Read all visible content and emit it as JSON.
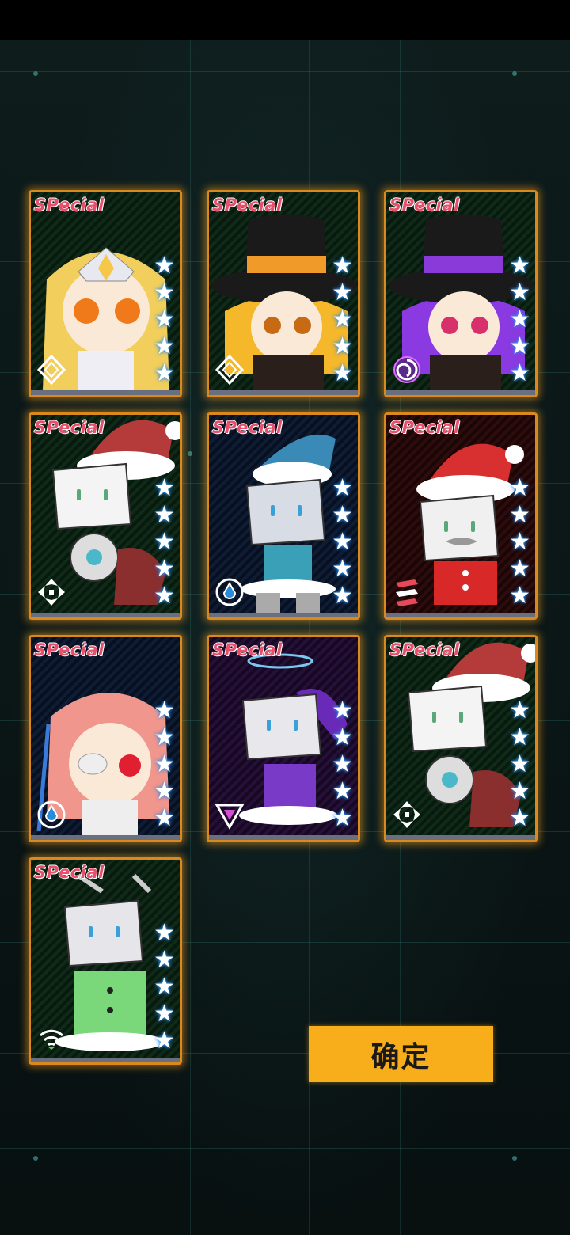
{
  "confirm_label": "确定",
  "cards": [
    {
      "rarity": "SPecial",
      "stars": 5,
      "theme": "green",
      "class_icon": "diamond-class-icon",
      "character": "golden-haired-crowned-character"
    },
    {
      "rarity": "SPecial",
      "stars": 5,
      "theme": "green",
      "class_icon": "diamond-class-icon",
      "character": "top-hat-orange-band-character"
    },
    {
      "rarity": "SPecial",
      "stars": 5,
      "theme": "green",
      "class_icon": "swirl-class-icon",
      "character": "top-hat-purple-band-character"
    },
    {
      "rarity": "SPecial",
      "stars": 5,
      "theme": "green",
      "class_icon": "crosshair-class-icon",
      "character": "box-head-santa-hat-spider-character"
    },
    {
      "rarity": "SPecial",
      "stars": 5,
      "theme": "blue",
      "class_icon": "drop-class-icon",
      "character": "box-head-blue-nightcap-character"
    },
    {
      "rarity": "SPecial",
      "stars": 5,
      "theme": "red",
      "class_icon": "slash-class-icon",
      "character": "box-head-santa-mustache-character"
    },
    {
      "rarity": "SPecial",
      "stars": 5,
      "theme": "blue",
      "class_icon": "drop-class-icon",
      "character": "pink-haired-eyepatch-character"
    },
    {
      "rarity": "SPecial",
      "stars": 5,
      "theme": "purple",
      "class_icon": "triangle-class-icon",
      "character": "box-head-halo-purple-character"
    },
    {
      "rarity": "SPecial",
      "stars": 5,
      "theme": "green",
      "class_icon": "crosshair-class-icon",
      "character": "box-head-santa-hat-spider-character"
    },
    {
      "rarity": "SPecial",
      "stars": 5,
      "theme": "green",
      "class_icon": "signal-class-icon",
      "character": "box-head-green-coat-character"
    }
  ],
  "colors": {
    "accent": "#f8ad1a",
    "card_border": "#d9891e",
    "rarity_text": "#e6506a",
    "star": "#ffffff"
  }
}
